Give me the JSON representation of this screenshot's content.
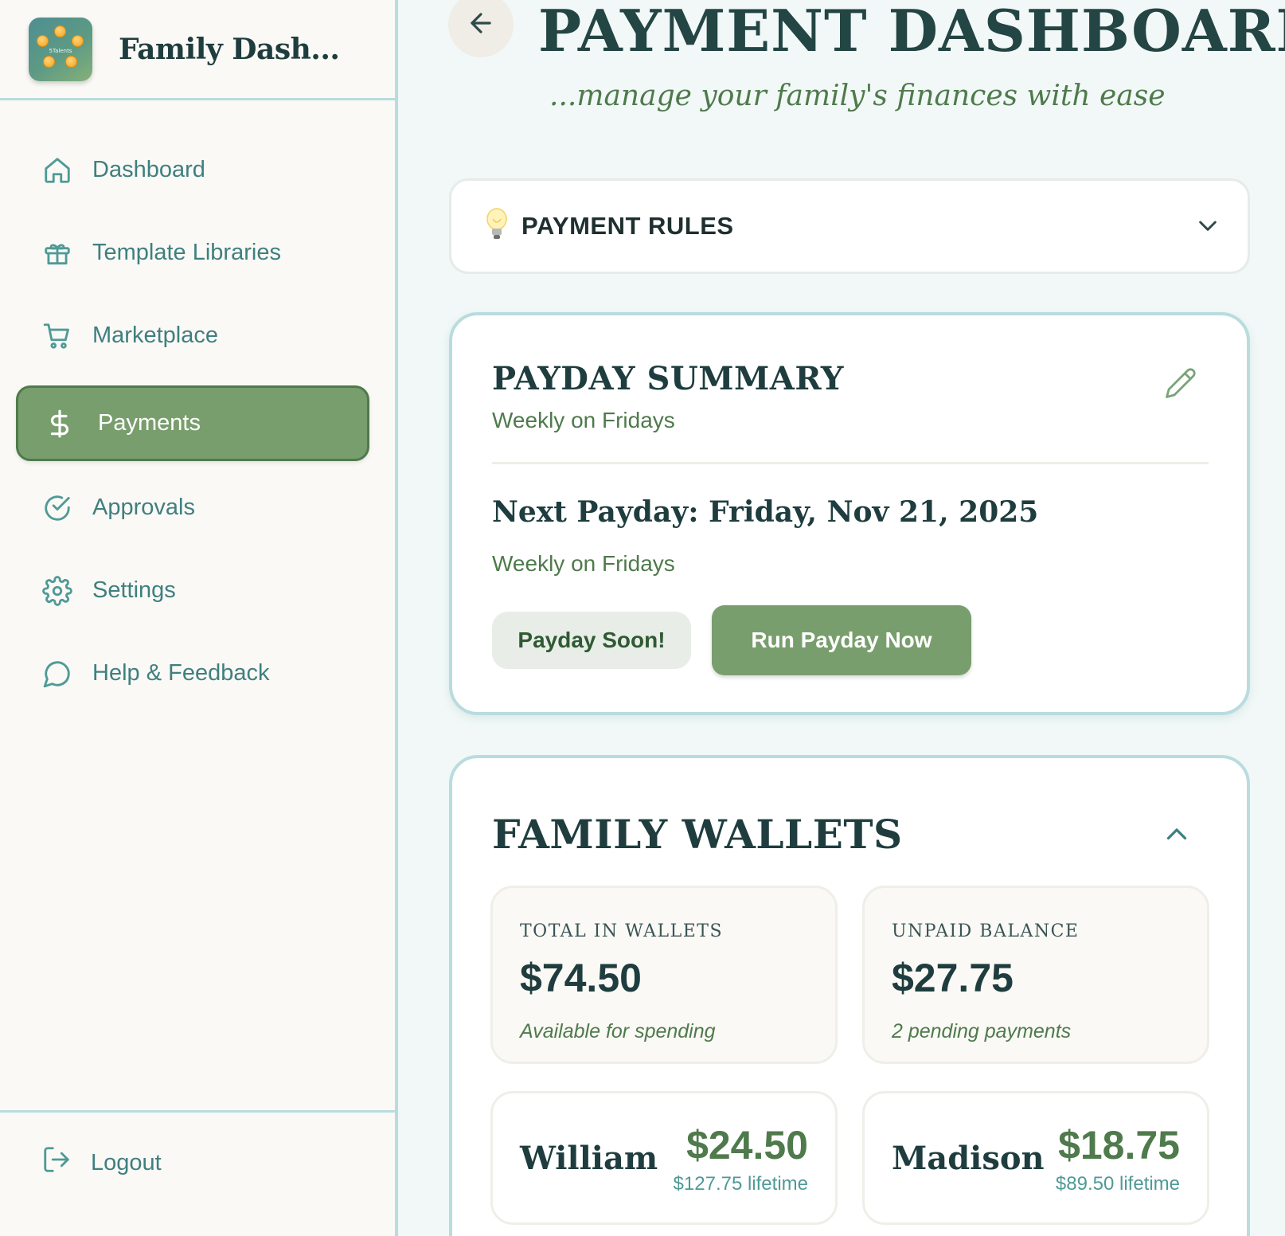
{
  "sidebar": {
    "brand_title": "Family Dash...",
    "logo_text": "5Talents",
    "items": [
      {
        "label": "Dashboard",
        "icon": "home-icon"
      },
      {
        "label": "Template Libraries",
        "icon": "gift-icon"
      },
      {
        "label": "Marketplace",
        "icon": "cart-icon"
      },
      {
        "label": "Payments",
        "icon": "dollar-icon",
        "active": true
      },
      {
        "label": "Approvals",
        "icon": "check-circle-icon"
      },
      {
        "label": "Settings",
        "icon": "gear-icon"
      },
      {
        "label": "Help & Feedback",
        "icon": "chat-bubble-icon"
      }
    ],
    "logout_label": "Logout"
  },
  "header": {
    "title": "PAYMENT DASHBOARD",
    "subtitle": "...manage your family's finances with ease"
  },
  "payment_rules": {
    "title": "PAYMENT RULES",
    "icon": "lightbulb-icon",
    "expanded": false
  },
  "payday_summary": {
    "title": "PAYDAY SUMMARY",
    "schedule": "Weekly on Fridays",
    "next_payday": "Next Payday: Friday, Nov 21, 2025",
    "next_schedule": "Weekly on Fridays",
    "badge": "Payday Soon!",
    "run_button": "Run Payday Now"
  },
  "family_wallets": {
    "title": "FAMILY WALLETS",
    "expanded": true,
    "stats": [
      {
        "label": "TOTAL IN WALLETS",
        "value": "$74.50",
        "note": "Available for spending"
      },
      {
        "label": "UNPAID BALANCE",
        "value": "$27.75",
        "note": "2 pending payments"
      }
    ],
    "members": [
      {
        "name": "William",
        "balance": "$24.50",
        "lifetime": "$127.75 lifetime"
      },
      {
        "name": "Madison",
        "balance": "$18.75",
        "lifetime": "$89.50 lifetime"
      }
    ]
  },
  "colors": {
    "accent_green": "#799e6d",
    "teal_text": "#3f7f7f",
    "border_teal": "#b9dcdf",
    "dark_heading": "#1f3d3e"
  }
}
